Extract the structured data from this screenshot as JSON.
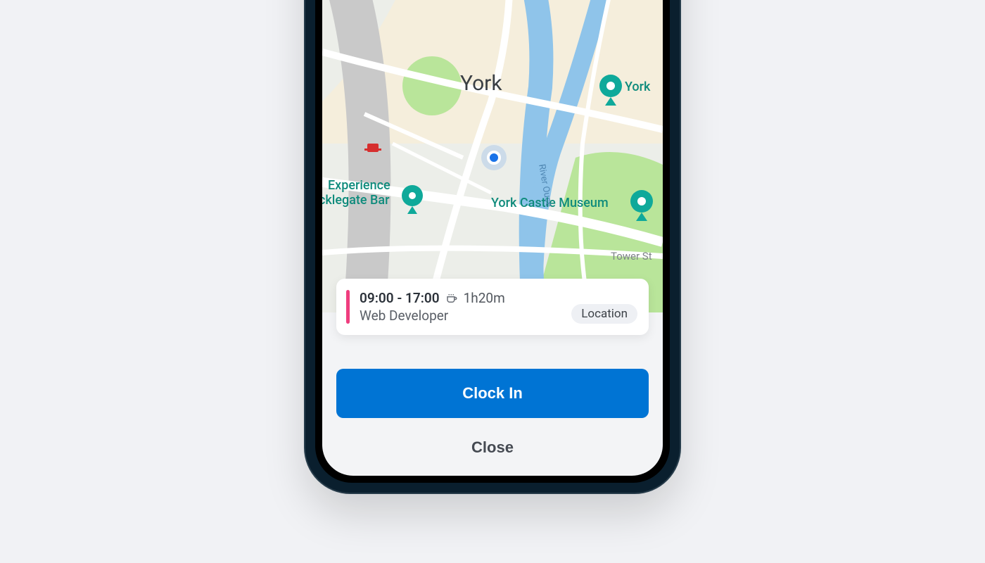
{
  "map": {
    "city_label": "York",
    "pois": {
      "york_museum_prefix": "York",
      "experience_line1": "Experience",
      "experience_line2": "cklegate Bar",
      "castle_museum": "York Castle Museum"
    },
    "streets": {
      "tower": "Tower St",
      "river": "River Ouse"
    }
  },
  "shift": {
    "time": "09:00 - 17:00",
    "break": "1h20m",
    "role": "Web Developer",
    "location_label": "Location"
  },
  "actions": {
    "clock_in": "Clock In",
    "close": "Close"
  },
  "colors": {
    "primary": "#0074d4",
    "shift_accent": "#ef3d7e",
    "user_dot": "#1a73e8"
  }
}
